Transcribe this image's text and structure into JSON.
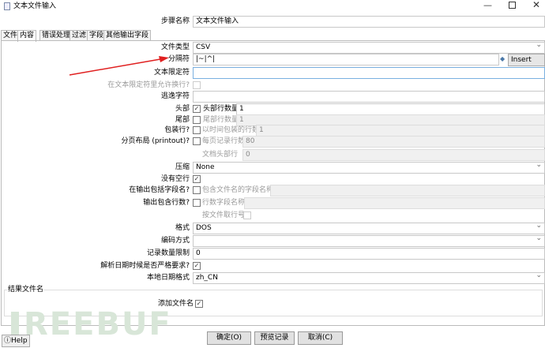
{
  "window": {
    "title": "文本文件输入"
  },
  "step_name": {
    "label": "步骤名称",
    "value": "文本文件输入"
  },
  "tabs": [
    "文件",
    "内容",
    "错误处理",
    "过滤",
    "字段",
    "其他输出字段"
  ],
  "content": {
    "file_type": {
      "label": "文件类型",
      "value": "CSV"
    },
    "separator": {
      "label": "分隔符",
      "value": "|~|^|",
      "button": "Insert TAB"
    },
    "enclosure": {
      "label": "文本限定符",
      "value": ""
    },
    "allow_breaks": {
      "label": "在文本限定符里允许换行?"
    },
    "escape": {
      "label": "逃逸字符",
      "value": ""
    },
    "header": {
      "label": "头部",
      "sub_label": "头部行数量",
      "value": "1"
    },
    "footer": {
      "label": "尾部",
      "sub_label": "尾部行数量",
      "value": "1"
    },
    "wrap": {
      "label": "包装行?",
      "sub_label": "以时间包装的行数",
      "value": "1"
    },
    "layout": {
      "label": "分页布局 (printout)?",
      "sub_label": "每页记录行数",
      "value": "80"
    },
    "doc_header": {
      "label": "文档头部行",
      "value": "0"
    },
    "compression": {
      "label": "压缩",
      "value": "None"
    },
    "no_empty": {
      "label": "没有空行"
    },
    "include_filename": {
      "label": "在输出包括字段名?",
      "sub_label": "包含文件名的字段名称"
    },
    "include_rownum": {
      "label": "输出包含行数?",
      "sub_label": "行数字段名称"
    },
    "rownum_by_file": {
      "label": "按文件取行号"
    },
    "format": {
      "label": "格式",
      "value": "DOS"
    },
    "encoding": {
      "label": "编码方式",
      "value": ""
    },
    "limit": {
      "label": "记录数量限制",
      "value": "0"
    },
    "date_lenient": {
      "label": "解析日期时候是否严格要求?"
    },
    "date_locale": {
      "label": "本地日期格式",
      "value": "zh_CN"
    },
    "result_group": {
      "title": "结果文件名",
      "add_filename": "添加文件名"
    }
  },
  "buttons": {
    "ok": "确定(O)",
    "preview": "预览记录",
    "cancel": "取消(C)",
    "help": "Help"
  },
  "watermark": "REEBUF"
}
